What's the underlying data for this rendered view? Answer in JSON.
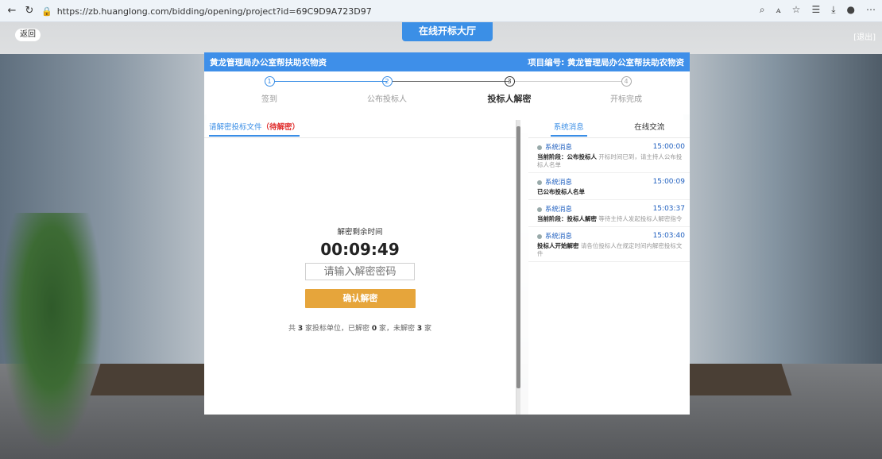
{
  "browser": {
    "url": "https://zb.huanglong.com/bidding/opening/project?id=69C9D9A723D97"
  },
  "page": {
    "back_label": "返回",
    "exit_label": "[退出]",
    "hall_title": "在线开标大厅"
  },
  "panel": {
    "header_left": "黄龙管理局办公室帮扶助农物资",
    "header_right": "项目编号: 黄龙管理局办公室帮扶助农物资",
    "steps": [
      {
        "num": "1",
        "label": "签到",
        "state": "done"
      },
      {
        "num": "2",
        "label": "公布投标人",
        "state": "done"
      },
      {
        "num": "3",
        "label": "投标人解密",
        "state": "active"
      },
      {
        "num": "4",
        "label": "开标完成",
        "state": "pending"
      }
    ]
  },
  "left": {
    "tab_label": "请解密投标文件",
    "tab_status": "（待解密）",
    "remain_label": "解密剩余时间",
    "timer": "00:09:49",
    "password_placeholder": "请输入解密密码",
    "confirm_label": "确认解密",
    "summary_prefix": "共",
    "summary_total": "3",
    "summary_mid1": "家投标单位，已解密",
    "summary_decrypted": "0",
    "summary_mid2": "家，未解密",
    "summary_undecrypted": "3",
    "summary_suffix": "家"
  },
  "right": {
    "tabs": [
      "系统消息",
      "在线交流"
    ],
    "messages": [
      {
        "sender": "系统消息",
        "time": "15:00:00",
        "bold": "当前阶段：公布投标人",
        "text": "开标时间已到，请主持人公布投标人名单"
      },
      {
        "sender": "系统消息",
        "time": "15:00:09",
        "bold": "已公布投标人名单",
        "text": ""
      },
      {
        "sender": "系统消息",
        "time": "15:03:37",
        "bold": "当前阶段：投标人解密",
        "text": "等待主持人发起投标人解密指令"
      },
      {
        "sender": "系统消息",
        "time": "15:03:40",
        "bold": "投标人开始解密",
        "text": "请各位投标人在规定时间内解密投标文件"
      }
    ]
  },
  "colors": {
    "header_blue": "#3e8fe9",
    "confirm_orange": "#e6a53b",
    "status_red": "#e0302f"
  }
}
